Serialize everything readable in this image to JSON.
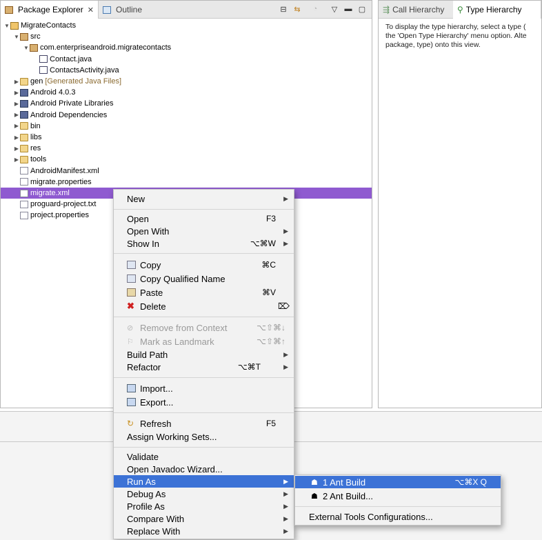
{
  "package_explorer": {
    "tab_label": "Package Explorer",
    "outline_tab_label": "Outline",
    "tree": [
      {
        "label": "MigrateContacts",
        "icon": "project-icon",
        "arrow": "▼",
        "depth": 0
      },
      {
        "label": "src",
        "icon": "source-folder-icon",
        "arrow": "▼",
        "depth": 1
      },
      {
        "label": "com.enterpriseandroid.migratecontacts",
        "icon": "package-icon",
        "arrow": "▼",
        "depth": 2
      },
      {
        "label": "Contact.java",
        "icon": "java-file-icon",
        "arrow": "",
        "depth": 3
      },
      {
        "label": "ContactsActivity.java",
        "icon": "java-file-icon",
        "arrow": "",
        "depth": 3
      },
      {
        "label": "gen",
        "suffix": "[Generated Java Files]",
        "icon": "folder-icon",
        "arrow": "▶",
        "depth": 1
      },
      {
        "label": "Android 4.0.3",
        "icon": "library-icon",
        "arrow": "▶",
        "depth": 1
      },
      {
        "label": "Android Private Libraries",
        "icon": "library-icon",
        "arrow": "▶",
        "depth": 1
      },
      {
        "label": "Android Dependencies",
        "icon": "library-icon",
        "arrow": "▶",
        "depth": 1
      },
      {
        "label": "bin",
        "icon": "folder-icon",
        "arrow": "▶",
        "depth": 1
      },
      {
        "label": "libs",
        "icon": "folder-icon",
        "arrow": "▶",
        "depth": 1
      },
      {
        "label": "res",
        "icon": "folder-icon",
        "arrow": "▶",
        "depth": 1
      },
      {
        "label": "tools",
        "icon": "folder-icon",
        "arrow": "▶",
        "depth": 1
      },
      {
        "label": "AndroidManifest.xml",
        "icon": "xml-file-icon",
        "arrow": "",
        "depth": 1
      },
      {
        "label": "migrate.properties",
        "icon": "file-icon",
        "arrow": "",
        "depth": 1
      },
      {
        "label": "migrate.xml",
        "icon": "xml-file-icon",
        "arrow": "",
        "depth": 1,
        "selected": true
      },
      {
        "label": "proguard-project.txt",
        "icon": "file-icon",
        "arrow": "",
        "depth": 1
      },
      {
        "label": "project.properties",
        "icon": "file-icon",
        "arrow": "",
        "depth": 1
      }
    ]
  },
  "type_hierarchy": {
    "call_tab_label": "Call Hierarchy",
    "type_tab_label": "Type Hierarchy",
    "line1": "To display the type hierarchy, select a type (",
    "line2": "the 'Open Type Hierarchy' menu option. Alte",
    "line3": "package, type) onto this view."
  },
  "context_menu": {
    "new": "New",
    "open": "Open",
    "open_sc": "F3",
    "open_with": "Open With",
    "show_in": "Show In",
    "show_in_sc": "⌥⌘W",
    "copy": "Copy",
    "copy_sc": "⌘C",
    "copy_qualified": "Copy Qualified Name",
    "paste": "Paste",
    "paste_sc": "⌘V",
    "delete": "Delete",
    "delete_sc": "⌦",
    "remove_context": "Remove from Context",
    "remove_context_sc": "⌥⇧⌘↓",
    "mark_landmark": "Mark as Landmark",
    "mark_landmark_sc": "⌥⇧⌘↑",
    "build_path": "Build Path",
    "refactor": "Refactor",
    "refactor_sc": "⌥⌘T",
    "import": "Import...",
    "export": "Export...",
    "refresh": "Refresh",
    "refresh_sc": "F5",
    "assign_working_sets": "Assign Working Sets...",
    "validate": "Validate",
    "open_javadoc": "Open Javadoc Wizard...",
    "run_as": "Run As",
    "debug_as": "Debug As",
    "profile_as": "Profile As",
    "compare_with": "Compare With",
    "replace_with": "Replace With"
  },
  "run_as_submenu": {
    "ant_build": "1 Ant Build",
    "ant_build_sc": "⌥⌘X Q",
    "ant_build_dialog": "2 Ant Build...",
    "external_tools": "External Tools Configurations..."
  },
  "colors": {
    "selection": "#8f5ad0",
    "menu_highlight": "#3c72d6"
  }
}
